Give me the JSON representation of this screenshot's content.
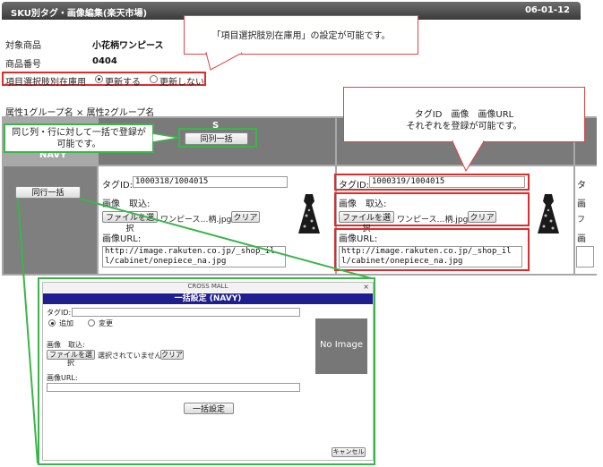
{
  "header": {
    "title": "SKU別タグ・画像編集(楽天市場)",
    "code": "06-01-12"
  },
  "product": {
    "name_label": "対象商品",
    "name_value": "小花柄ワンピース",
    "number_label": "商品番号",
    "number_value": "0404"
  },
  "stock_option": {
    "label": "項目選択肢別在庫用",
    "opt_yes": "更新する",
    "opt_no": "更新しない",
    "selected": "yes"
  },
  "group_label": "属性1グループ名 × 属性2グループ名",
  "callouts": {
    "top": "「項目選択肢別在庫用」の設定が可能です。",
    "right_line1": "タグID　画像　画像URL",
    "right_line2": "それぞれを登録が可能です。",
    "left_line1": "同じ列・行に対して一括で登録が",
    "left_line2": "可能です。"
  },
  "grid": {
    "col_header": "S",
    "col_bulk_button": "同列一括",
    "row_header": "NAVY",
    "row_bulk_button": "同行一括",
    "cells": [
      {
        "tagid_label": "タグID:",
        "tagid_value": "1000318/1004015",
        "image_label": "画像　取込:",
        "file_button": "ファイルを選択",
        "file_name": "ワンピース…柄.jpg",
        "clear_button": "クリア",
        "url_label": "画像URL:",
        "url_value": "http://image.rakuten.co.jp/_shop_ill/cabinet/onepiece_na.jpg"
      },
      {
        "tagid_label": "タグID:",
        "tagid_value": "1000319/1004015",
        "image_label": "画像　取込:",
        "file_button": "ファイルを選択",
        "file_name": "ワンピース…柄.jpg",
        "clear_button": "クリア",
        "url_label": "画像URL:",
        "url_value": "http://image.rakuten.co.jp/_shop_ill/cabinet/onepiece_na.jpg"
      }
    ],
    "partial_labels": [
      "タ",
      "画",
      "フ",
      "画"
    ]
  },
  "modal": {
    "window_title": "CROSS MALL",
    "heading": "一括設定 (NAVY)",
    "tagid_label": "タグID:",
    "radio_add": "追加",
    "radio_change": "変更",
    "radio_selected": "add",
    "image_label": "画像　取込:",
    "file_button": "ファイルを選択",
    "file_status": "選択されていません",
    "clear_button": "クリア",
    "url_label": "画像URL:",
    "no_image": "No Image",
    "submit_button": "一括設定",
    "cancel_button": "キャンセル",
    "close_symbol": "×"
  },
  "colors": {
    "red": "#e02b2b",
    "green": "#3bb54a",
    "modal_bar": "#1f1f8f"
  }
}
